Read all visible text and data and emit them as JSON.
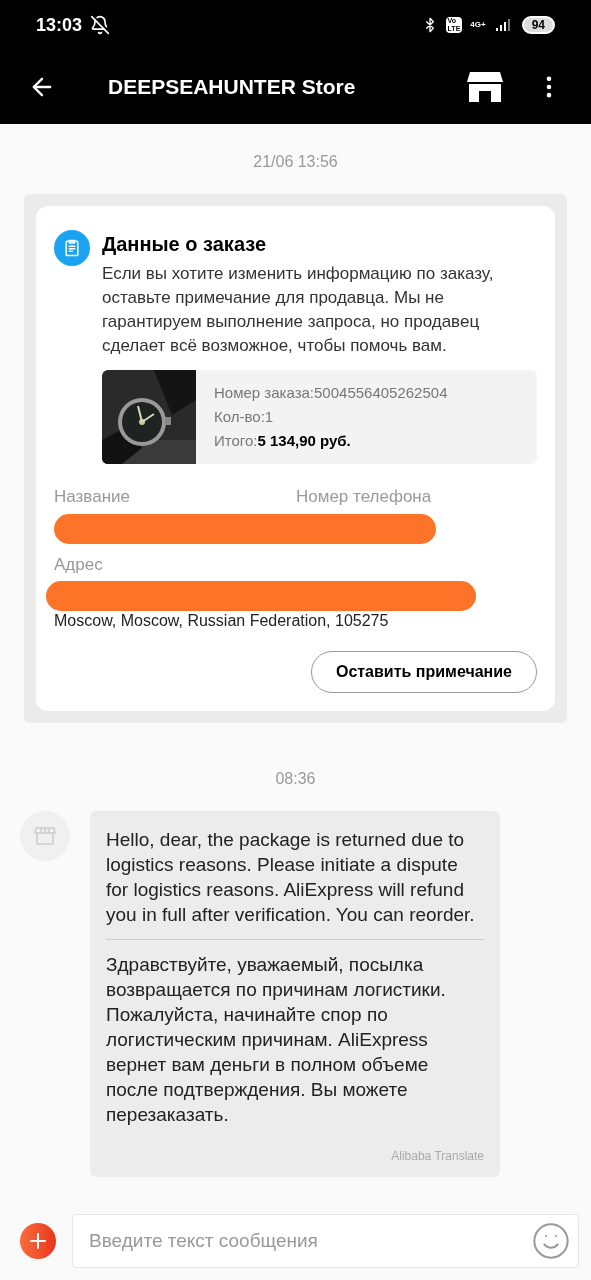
{
  "status_bar": {
    "time": "13:03",
    "battery": "94",
    "network": "4G+",
    "volte_top": "Vo",
    "volte_bottom": "LTE"
  },
  "header": {
    "title": "DEEPSEAHUNTER Store"
  },
  "messages": [
    {
      "kind": "order",
      "timestamp": "21/06 13:56",
      "title": "Данные о заказе",
      "description": "Если вы хотите изменить информацию по заказу, оставьте примечание для продавца. Мы не гарантируем выполнение запроса, но продавец сделает всё возможное, чтобы помочь вам.",
      "order_number": "Номер заказа:5004556405262504",
      "quantity": "Кол-во:1",
      "total_label": "Итого:",
      "total_value": "5 134,90 руб.",
      "name_label": "Название",
      "phone_label": "Номер телефона",
      "address_label": "Адрес",
      "address_line": "Moscow, Moscow, Russian Federation, 105275",
      "button": "Оставить примечание"
    },
    {
      "kind": "text",
      "timestamp": "08:36",
      "original": "Hello, dear, the package is returned due to logistics reasons. Please initiate a dispute for logistics reasons. AliExpress will refund you in full after verification. You can reorder.",
      "translation": "Здравствуйте, уважаемый, посылка возвращается по причинам логистики. Пожалуйста, начинайте спор по логистическим причинам. AliExpress вернет вам деньги в полном объеме после подтверждения. Вы можете перезаказать.",
      "translator": "Alibaba Translate"
    }
  ],
  "composer": {
    "placeholder": "Введите текст сообщения"
  }
}
